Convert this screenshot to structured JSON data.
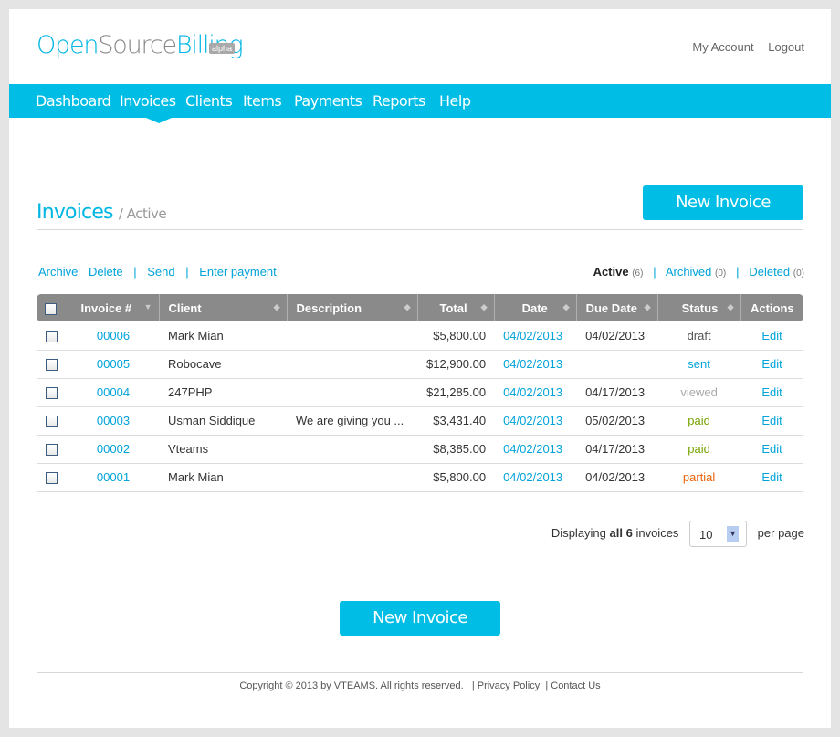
{
  "brand": {
    "part1": "Open",
    "part2": "Source",
    "part3": "Billing",
    "badge": "alpha"
  },
  "top_links": [
    "My Account",
    "Logout"
  ],
  "nav": [
    "Dashboard",
    "Invoices",
    "Clients",
    "Items",
    "Payments",
    "Reports",
    "Help"
  ],
  "page": {
    "title": "Invoices",
    "subtitle": "/ Active",
    "new_invoice": "New Invoice"
  },
  "bulk_actions": [
    "Archive",
    "Delete",
    "|",
    "Send",
    "|",
    "Enter payment"
  ],
  "filters": {
    "active": "Active",
    "active_count": "(6)",
    "archived": "Archived",
    "archived_count": "(0)",
    "deleted": "Deleted",
    "deleted_count": "(0)",
    "sep": "|"
  },
  "columns": [
    "Invoice #",
    "Client",
    "Description",
    "Total",
    "Date",
    "Due Date",
    "Status",
    "Actions"
  ],
  "rows": [
    {
      "num": "00006",
      "client": "Mark Mian",
      "desc": "",
      "total": "$5,800.00",
      "date": "04/02/2013",
      "due": "04/02/2013",
      "status": "draft",
      "action": "Edit"
    },
    {
      "num": "00005",
      "client": "Robocave",
      "desc": "",
      "total": "$12,900.00",
      "date": "04/02/2013",
      "due": "",
      "status": "sent",
      "action": "Edit"
    },
    {
      "num": "00004",
      "client": "247PHP",
      "desc": "",
      "total": "$21,285.00",
      "date": "04/02/2013",
      "due": "04/17/2013",
      "status": "viewed",
      "action": "Edit"
    },
    {
      "num": "00003",
      "client": "Usman Siddique",
      "desc": "We are giving you ...",
      "total": "$3,431.40",
      "date": "04/02/2013",
      "due": "05/02/2013",
      "status": "paid",
      "action": "Edit"
    },
    {
      "num": "00002",
      "client": "Vteams",
      "desc": "",
      "total": "$8,385.00",
      "date": "04/02/2013",
      "due": "04/17/2013",
      "status": "paid",
      "action": "Edit"
    },
    {
      "num": "00001",
      "client": "Mark Mian",
      "desc": "",
      "total": "$5,800.00",
      "date": "04/02/2013",
      "due": "04/02/2013",
      "status": "partial",
      "action": "Edit"
    }
  ],
  "status_colors": {
    "draft": "#555555",
    "sent": "#00a3d9",
    "viewed": "#aaaaaa",
    "paid": "#77a300",
    "partial": "#e8620b"
  },
  "pager": {
    "prefix": "Displaying",
    "bold": "all 6",
    "suffix": "invoices",
    "per_page_value": "10",
    "per_page_label": "per page"
  },
  "footer": {
    "copyright": "Copyright © 2013 by VTEAMS. All rights reserved.",
    "sep": "|",
    "privacy": "Privacy Policy",
    "contact": "Contact Us"
  }
}
